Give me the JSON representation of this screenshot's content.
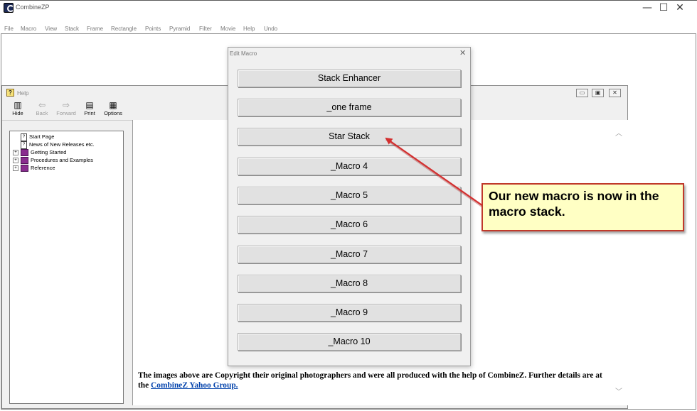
{
  "app": {
    "title": "CombineZP"
  },
  "window_controls": {
    "minimize": "—",
    "maximize": "☐",
    "close": "✕"
  },
  "menu": [
    "File",
    "Macro",
    "View",
    "Stack",
    "Frame",
    "Rectangle",
    "Points",
    "Pyramid",
    "Filter",
    "Movie",
    "Help",
    "Undo"
  ],
  "help": {
    "title": "Help",
    "toolbar": [
      {
        "label": "Hide",
        "icon": "hide-icon",
        "enabled": true
      },
      {
        "label": "Back",
        "icon": "back-arrow-icon",
        "enabled": false
      },
      {
        "label": "Forward",
        "icon": "forward-arrow-icon",
        "enabled": false
      },
      {
        "label": "Print",
        "icon": "printer-icon",
        "enabled": true
      },
      {
        "label": "Options",
        "icon": "options-icon",
        "enabled": true
      }
    ],
    "toc": [
      {
        "label": "Start Page",
        "icon": "page-icon",
        "expandable": false
      },
      {
        "label": "News of New Releases etc.",
        "icon": "page-icon",
        "expandable": false
      },
      {
        "label": "Getting Started",
        "icon": "book-icon",
        "expandable": true
      },
      {
        "label": "Procedures and Examples",
        "icon": "book-icon",
        "expandable": true
      },
      {
        "label": "Reference",
        "icon": "book-icon",
        "expandable": true
      }
    ],
    "content_text": "The images above are Copyright their original photographers and were all produced with the help of CombineZ.   Further details are at the ",
    "content_link": "CombineZ Yahoo Group."
  },
  "dialog": {
    "title": "Edit Macro",
    "buttons": [
      "Stack Enhancer",
      "_one frame",
      "Star Stack",
      "_Macro 4",
      "_Macro 5",
      "_Macro 6",
      "_Macro 7",
      "_Macro 8",
      "_Macro 9",
      "_Macro 10"
    ]
  },
  "callout": {
    "text": "Our new macro is now in the macro stack.",
    "border_color": "#c0392b",
    "fill_color": "#ffffc4"
  }
}
